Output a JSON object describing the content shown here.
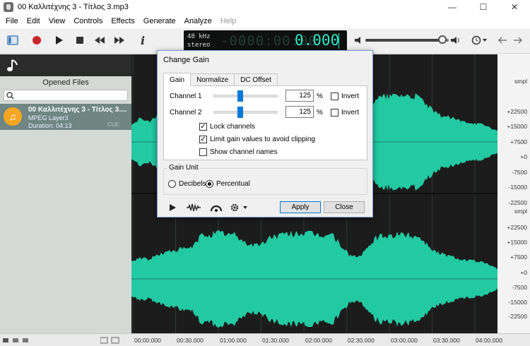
{
  "window": {
    "title": "00 Καλλιτέχνης 3 - Τίτλος 3.mp3",
    "controls": [
      "minimize-icon",
      "maximize-icon",
      "close-icon"
    ]
  },
  "menu": {
    "items": [
      "File",
      "Edit",
      "View",
      "Controls",
      "Effects",
      "Generate",
      "Analyze",
      "Help"
    ]
  },
  "toolbar": {
    "icons": [
      "view-toggle-icon",
      "record-icon",
      "play-icon",
      "stop-icon",
      "rewind-icon",
      "fast-forward-icon",
      "info-icon"
    ],
    "info_label": "i"
  },
  "display": {
    "sample_rate": "48 kHz",
    "channels": "stereo",
    "dim_digits": "-0000:00:00",
    "value": "0.000"
  },
  "volume": {
    "level": 0.92
  },
  "left_panel": {
    "title": "Opened Files",
    "search_placeholder": "",
    "files": [
      {
        "name": "00 Καλλιτέχνης 3 - Τίτλος 3....",
        "format": "MPEG Layer3",
        "duration": "Duration: 04:13",
        "cue": "CUE"
      }
    ]
  },
  "scale": {
    "unit": "smpl",
    "channel1": [
      "smpl",
      "+22500",
      "+15000",
      "+7500",
      "+0",
      "-7500",
      "-15000",
      "-22500"
    ],
    "channel2": [
      "smpl",
      "+22500",
      "+15000",
      "+7500",
      "+0",
      "-7500",
      "-15000",
      "-22500"
    ]
  },
  "timeline": {
    "labels": [
      "00:00.000",
      "00:30.000",
      "01:00.000",
      "01:30.000",
      "02:00.000",
      "02:30.000",
      "03:00.000",
      "03:30.000",
      "04:00.000"
    ]
  },
  "dialog": {
    "title": "Change Gain",
    "tabs": [
      "Gain",
      "Normalize",
      "DC Offset"
    ],
    "active_tab": "Gain",
    "channel1_label": "Channel 1",
    "channel1_value": "125",
    "channel2_label": "Channel 2",
    "channel2_value": "125",
    "percent_symbol": "%",
    "invert_label": "Invert",
    "lock_channels": {
      "label": "Lock channels",
      "checked": true
    },
    "limit_gain": {
      "label": "Limit gain values to avoid clipping",
      "checked": true
    },
    "show_names": {
      "label": "Show channel names",
      "checked": false
    },
    "gain_unit_title": "Gain Unit",
    "unit_decibels": "Decibels",
    "unit_percentual": "Percentual",
    "selected_unit": "Percentual",
    "apply_label": "Apply",
    "close_label": "Close"
  },
  "colors": {
    "waveform": "#22c9a1",
    "waveform_bg": "#1c1c1c",
    "accent": "#0078d7",
    "file_item_bg": "#6f8682"
  }
}
